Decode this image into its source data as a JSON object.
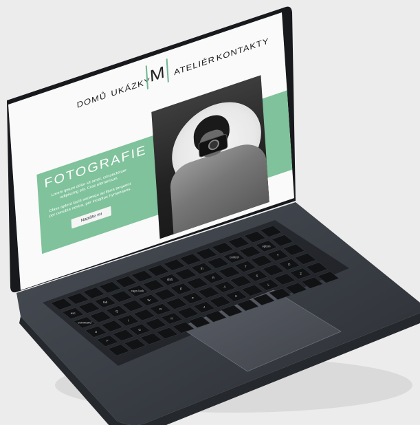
{
  "website": {
    "nav": {
      "items": [
        {
          "label": "DOMŮ"
        },
        {
          "label": "UKÁZKY"
        },
        {
          "label": "ATELIÉR"
        },
        {
          "label": "KONTAKTY"
        }
      ],
      "logo_letter": "M"
    },
    "hero": {
      "title": "FOTOGRAFIE",
      "paragraph1": "Lorem ipsum dolor sit amet, consectetuer adipiscing elit. Cras elementum.",
      "paragraph2": "Class aptent taciti sociosqu ad litora torquent per conubia nostra, per inceptos hymenaeos.",
      "button_label": "Napište mi"
    },
    "colors": {
      "accent": "#7fc29b",
      "background": "#fafafa"
    }
  },
  "keyboard": {
    "labels": [
      "esc",
      "tab",
      "caps lock",
      "shift",
      "fn",
      "control",
      "option",
      "command",
      "Q",
      "W",
      "E",
      "R",
      "T",
      "Y",
      "U",
      "I",
      "O",
      "P",
      "A",
      "S",
      "D",
      "F",
      "G",
      "H",
      "J",
      "K",
      "L",
      "Z",
      "X",
      "C",
      "V",
      "B",
      "N",
      "M",
      "delete",
      "return"
    ]
  }
}
